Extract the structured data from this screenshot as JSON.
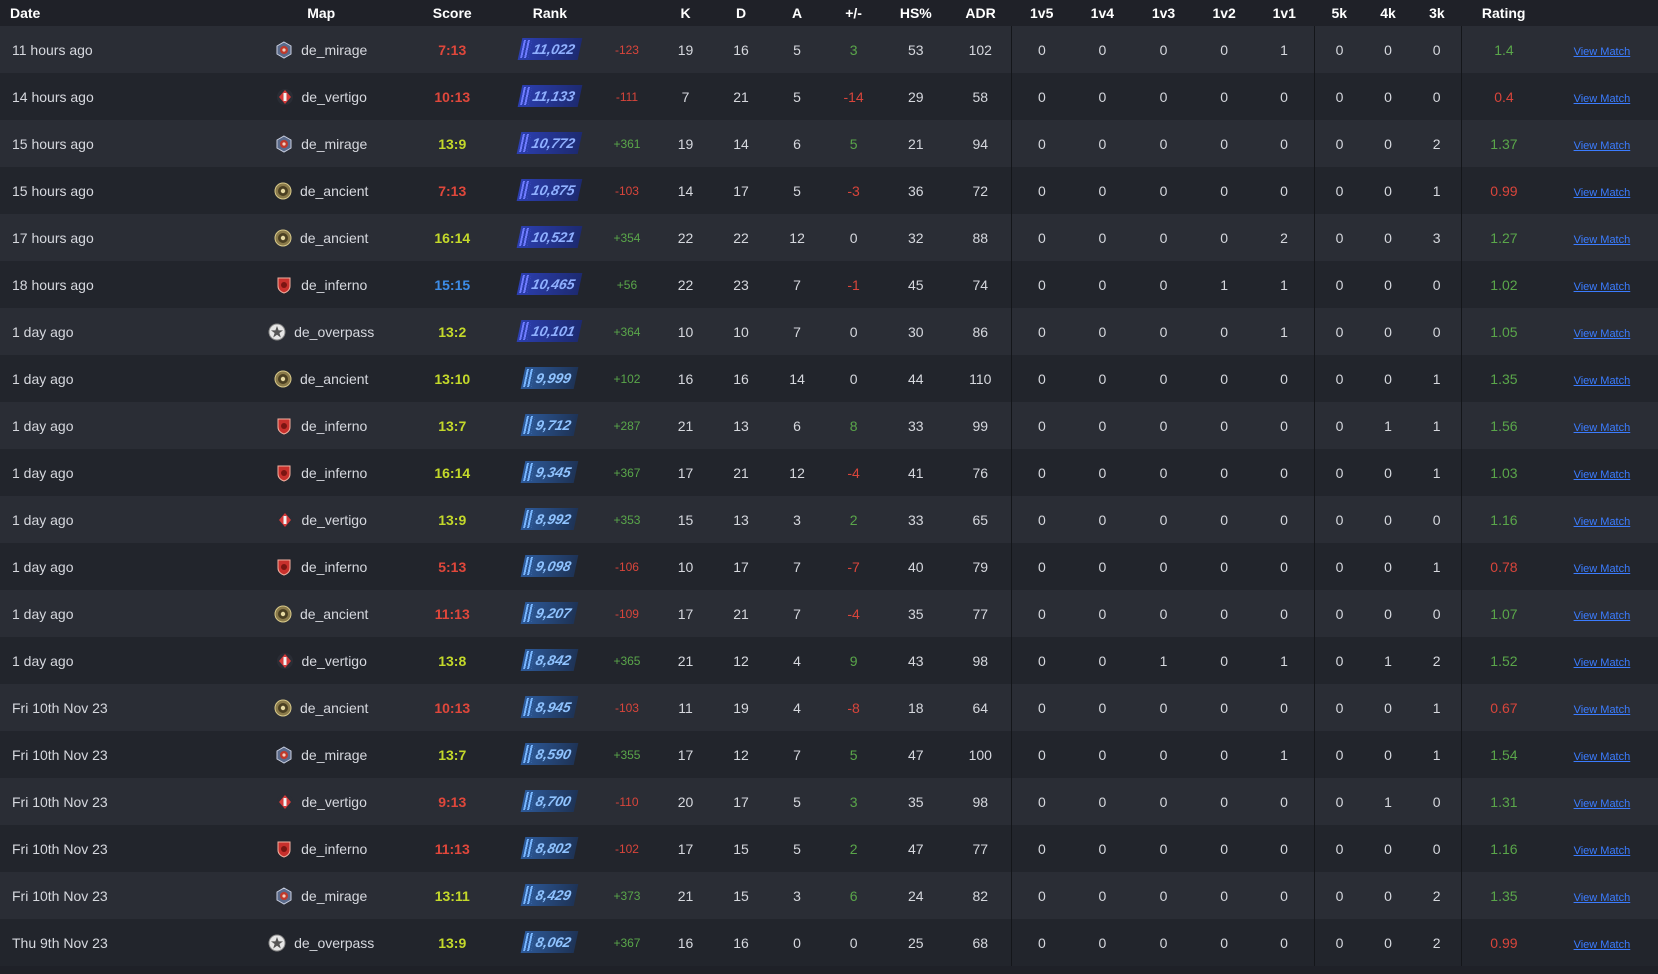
{
  "headers": [
    "Date",
    "Map",
    "Score",
    "Rank",
    "",
    "K",
    "D",
    "A",
    "+/-",
    "HS%",
    "ADR",
    "1v5",
    "1v4",
    "1v3",
    "1v2",
    "1v1",
    "5k",
    "4k",
    "3k",
    "Rating",
    ""
  ],
  "view_match_label": "View Match",
  "colors": {
    "win": "#c4d92a",
    "loss": "#e0473b",
    "tie": "#3d8de8",
    "positive": "#5aa64a",
    "negative": "#d9453b",
    "link": "#3b7cff"
  },
  "map_icons": {
    "de_mirage": "mirage-icon",
    "de_vertigo": "vertigo-icon",
    "de_ancient": "ancient-icon",
    "de_inferno": "inferno-icon",
    "de_overpass": "overpass-icon"
  },
  "rows": [
    {
      "date": "11 hours ago",
      "map": "de_mirage",
      "score": "7:13",
      "result": "loss",
      "rank": "11,022",
      "delta": "-123",
      "k": "19",
      "d": "16",
      "a": "5",
      "pm": "3",
      "hs": "53",
      "adr": "102",
      "v5": "0",
      "v4": "0",
      "v3": "0",
      "v2": "0",
      "v1": "1",
      "k5": "0",
      "k4": "0",
      "k3": "0",
      "rating": "1.4"
    },
    {
      "date": "14 hours ago",
      "map": "de_vertigo",
      "score": "10:13",
      "result": "loss",
      "rank": "11,133",
      "delta": "-111",
      "k": "7",
      "d": "21",
      "a": "5",
      "pm": "-14",
      "hs": "29",
      "adr": "58",
      "v5": "0",
      "v4": "0",
      "v3": "0",
      "v2": "0",
      "v1": "0",
      "k5": "0",
      "k4": "0",
      "k3": "0",
      "rating": "0.4"
    },
    {
      "date": "15 hours ago",
      "map": "de_mirage",
      "score": "13:9",
      "result": "win",
      "rank": "10,772",
      "delta": "+361",
      "k": "19",
      "d": "14",
      "a": "6",
      "pm": "5",
      "hs": "21",
      "adr": "94",
      "v5": "0",
      "v4": "0",
      "v3": "0",
      "v2": "0",
      "v1": "0",
      "k5": "0",
      "k4": "0",
      "k3": "2",
      "rating": "1.37"
    },
    {
      "date": "15 hours ago",
      "map": "de_ancient",
      "score": "7:13",
      "result": "loss",
      "rank": "10,875",
      "delta": "-103",
      "k": "14",
      "d": "17",
      "a": "5",
      "pm": "-3",
      "hs": "36",
      "adr": "72",
      "v5": "0",
      "v4": "0",
      "v3": "0",
      "v2": "0",
      "v1": "0",
      "k5": "0",
      "k4": "0",
      "k3": "1",
      "rating": "0.99"
    },
    {
      "date": "17 hours ago",
      "map": "de_ancient",
      "score": "16:14",
      "result": "win",
      "rank": "10,521",
      "delta": "+354",
      "k": "22",
      "d": "22",
      "a": "12",
      "pm": "0",
      "hs": "32",
      "adr": "88",
      "v5": "0",
      "v4": "0",
      "v3": "0",
      "v2": "0",
      "v1": "2",
      "k5": "0",
      "k4": "0",
      "k3": "3",
      "rating": "1.27"
    },
    {
      "date": "18 hours ago",
      "map": "de_inferno",
      "score": "15:15",
      "result": "tie",
      "rank": "10,465",
      "delta": "+56",
      "k": "22",
      "d": "23",
      "a": "7",
      "pm": "-1",
      "hs": "45",
      "adr": "74",
      "v5": "0",
      "v4": "0",
      "v3": "0",
      "v2": "1",
      "v1": "1",
      "k5": "0",
      "k4": "0",
      "k3": "0",
      "rating": "1.02"
    },
    {
      "date": "1 day ago",
      "map": "de_overpass",
      "score": "13:2",
      "result": "win",
      "rank": "10,101",
      "delta": "+364",
      "k": "10",
      "d": "10",
      "a": "7",
      "pm": "0",
      "hs": "30",
      "adr": "86",
      "v5": "0",
      "v4": "0",
      "v3": "0",
      "v2": "0",
      "v1": "1",
      "k5": "0",
      "k4": "0",
      "k3": "0",
      "rating": "1.05"
    },
    {
      "date": "1 day ago",
      "map": "de_ancient",
      "score": "13:10",
      "result": "win",
      "rank": "9,999",
      "delta": "+102",
      "k": "16",
      "d": "16",
      "a": "14",
      "pm": "0",
      "hs": "44",
      "adr": "110",
      "v5": "0",
      "v4": "0",
      "v3": "0",
      "v2": "0",
      "v1": "0",
      "k5": "0",
      "k4": "0",
      "k3": "1",
      "rating": "1.35"
    },
    {
      "date": "1 day ago",
      "map": "de_inferno",
      "score": "13:7",
      "result": "win",
      "rank": "9,712",
      "delta": "+287",
      "k": "21",
      "d": "13",
      "a": "6",
      "pm": "8",
      "hs": "33",
      "adr": "99",
      "v5": "0",
      "v4": "0",
      "v3": "0",
      "v2": "0",
      "v1": "0",
      "k5": "0",
      "k4": "1",
      "k3": "1",
      "rating": "1.56"
    },
    {
      "date": "1 day ago",
      "map": "de_inferno",
      "score": "16:14",
      "result": "win",
      "rank": "9,345",
      "delta": "+367",
      "k": "17",
      "d": "21",
      "a": "12",
      "pm": "-4",
      "hs": "41",
      "adr": "76",
      "v5": "0",
      "v4": "0",
      "v3": "0",
      "v2": "0",
      "v1": "0",
      "k5": "0",
      "k4": "0",
      "k3": "1",
      "rating": "1.03"
    },
    {
      "date": "1 day ago",
      "map": "de_vertigo",
      "score": "13:9",
      "result": "win",
      "rank": "8,992",
      "delta": "+353",
      "k": "15",
      "d": "13",
      "a": "3",
      "pm": "2",
      "hs": "33",
      "adr": "65",
      "v5": "0",
      "v4": "0",
      "v3": "0",
      "v2": "0",
      "v1": "0",
      "k5": "0",
      "k4": "0",
      "k3": "0",
      "rating": "1.16"
    },
    {
      "date": "1 day ago",
      "map": "de_inferno",
      "score": "5:13",
      "result": "loss",
      "rank": "9,098",
      "delta": "-106",
      "k": "10",
      "d": "17",
      "a": "7",
      "pm": "-7",
      "hs": "40",
      "adr": "79",
      "v5": "0",
      "v4": "0",
      "v3": "0",
      "v2": "0",
      "v1": "0",
      "k5": "0",
      "k4": "0",
      "k3": "1",
      "rating": "0.78"
    },
    {
      "date": "1 day ago",
      "map": "de_ancient",
      "score": "11:13",
      "result": "loss",
      "rank": "9,207",
      "delta": "-109",
      "k": "17",
      "d": "21",
      "a": "7",
      "pm": "-4",
      "hs": "35",
      "adr": "77",
      "v5": "0",
      "v4": "0",
      "v3": "0",
      "v2": "0",
      "v1": "0",
      "k5": "0",
      "k4": "0",
      "k3": "0",
      "rating": "1.07"
    },
    {
      "date": "1 day ago",
      "map": "de_vertigo",
      "score": "13:8",
      "result": "win",
      "rank": "8,842",
      "delta": "+365",
      "k": "21",
      "d": "12",
      "a": "4",
      "pm": "9",
      "hs": "43",
      "adr": "98",
      "v5": "0",
      "v4": "0",
      "v3": "1",
      "v2": "0",
      "v1": "1",
      "k5": "0",
      "k4": "1",
      "k3": "2",
      "rating": "1.52"
    },
    {
      "date": "Fri 10th Nov 23",
      "map": "de_ancient",
      "score": "10:13",
      "result": "loss",
      "rank": "8,945",
      "delta": "-103",
      "k": "11",
      "d": "19",
      "a": "4",
      "pm": "-8",
      "hs": "18",
      "adr": "64",
      "v5": "0",
      "v4": "0",
      "v3": "0",
      "v2": "0",
      "v1": "0",
      "k5": "0",
      "k4": "0",
      "k3": "1",
      "rating": "0.67"
    },
    {
      "date": "Fri 10th Nov 23",
      "map": "de_mirage",
      "score": "13:7",
      "result": "win",
      "rank": "8,590",
      "delta": "+355",
      "k": "17",
      "d": "12",
      "a": "7",
      "pm": "5",
      "hs": "47",
      "adr": "100",
      "v5": "0",
      "v4": "0",
      "v3": "0",
      "v2": "0",
      "v1": "1",
      "k5": "0",
      "k4": "0",
      "k3": "1",
      "rating": "1.54"
    },
    {
      "date": "Fri 10th Nov 23",
      "map": "de_vertigo",
      "score": "9:13",
      "result": "loss",
      "rank": "8,700",
      "delta": "-110",
      "k": "20",
      "d": "17",
      "a": "5",
      "pm": "3",
      "hs": "35",
      "adr": "98",
      "v5": "0",
      "v4": "0",
      "v3": "0",
      "v2": "0",
      "v1": "0",
      "k5": "0",
      "k4": "1",
      "k3": "0",
      "rating": "1.31"
    },
    {
      "date": "Fri 10th Nov 23",
      "map": "de_inferno",
      "score": "11:13",
      "result": "loss",
      "rank": "8,802",
      "delta": "-102",
      "k": "17",
      "d": "15",
      "a": "5",
      "pm": "2",
      "hs": "47",
      "adr": "77",
      "v5": "0",
      "v4": "0",
      "v3": "0",
      "v2": "0",
      "v1": "0",
      "k5": "0",
      "k4": "0",
      "k3": "0",
      "rating": "1.16"
    },
    {
      "date": "Fri 10th Nov 23",
      "map": "de_mirage",
      "score": "13:11",
      "result": "win",
      "rank": "8,429",
      "delta": "+373",
      "k": "21",
      "d": "15",
      "a": "3",
      "pm": "6",
      "hs": "24",
      "adr": "82",
      "v5": "0",
      "v4": "0",
      "v3": "0",
      "v2": "0",
      "v1": "0",
      "k5": "0",
      "k4": "0",
      "k3": "2",
      "rating": "1.35"
    },
    {
      "date": "Thu 9th Nov 23",
      "map": "de_overpass",
      "score": "13:9",
      "result": "win",
      "rank": "8,062",
      "delta": "+367",
      "k": "16",
      "d": "16",
      "a": "0",
      "pm": "0",
      "hs": "25",
      "adr": "68",
      "v5": "0",
      "v4": "0",
      "v3": "0",
      "v2": "0",
      "v1": "0",
      "k5": "0",
      "k4": "0",
      "k3": "2",
      "rating": "0.99"
    }
  ]
}
